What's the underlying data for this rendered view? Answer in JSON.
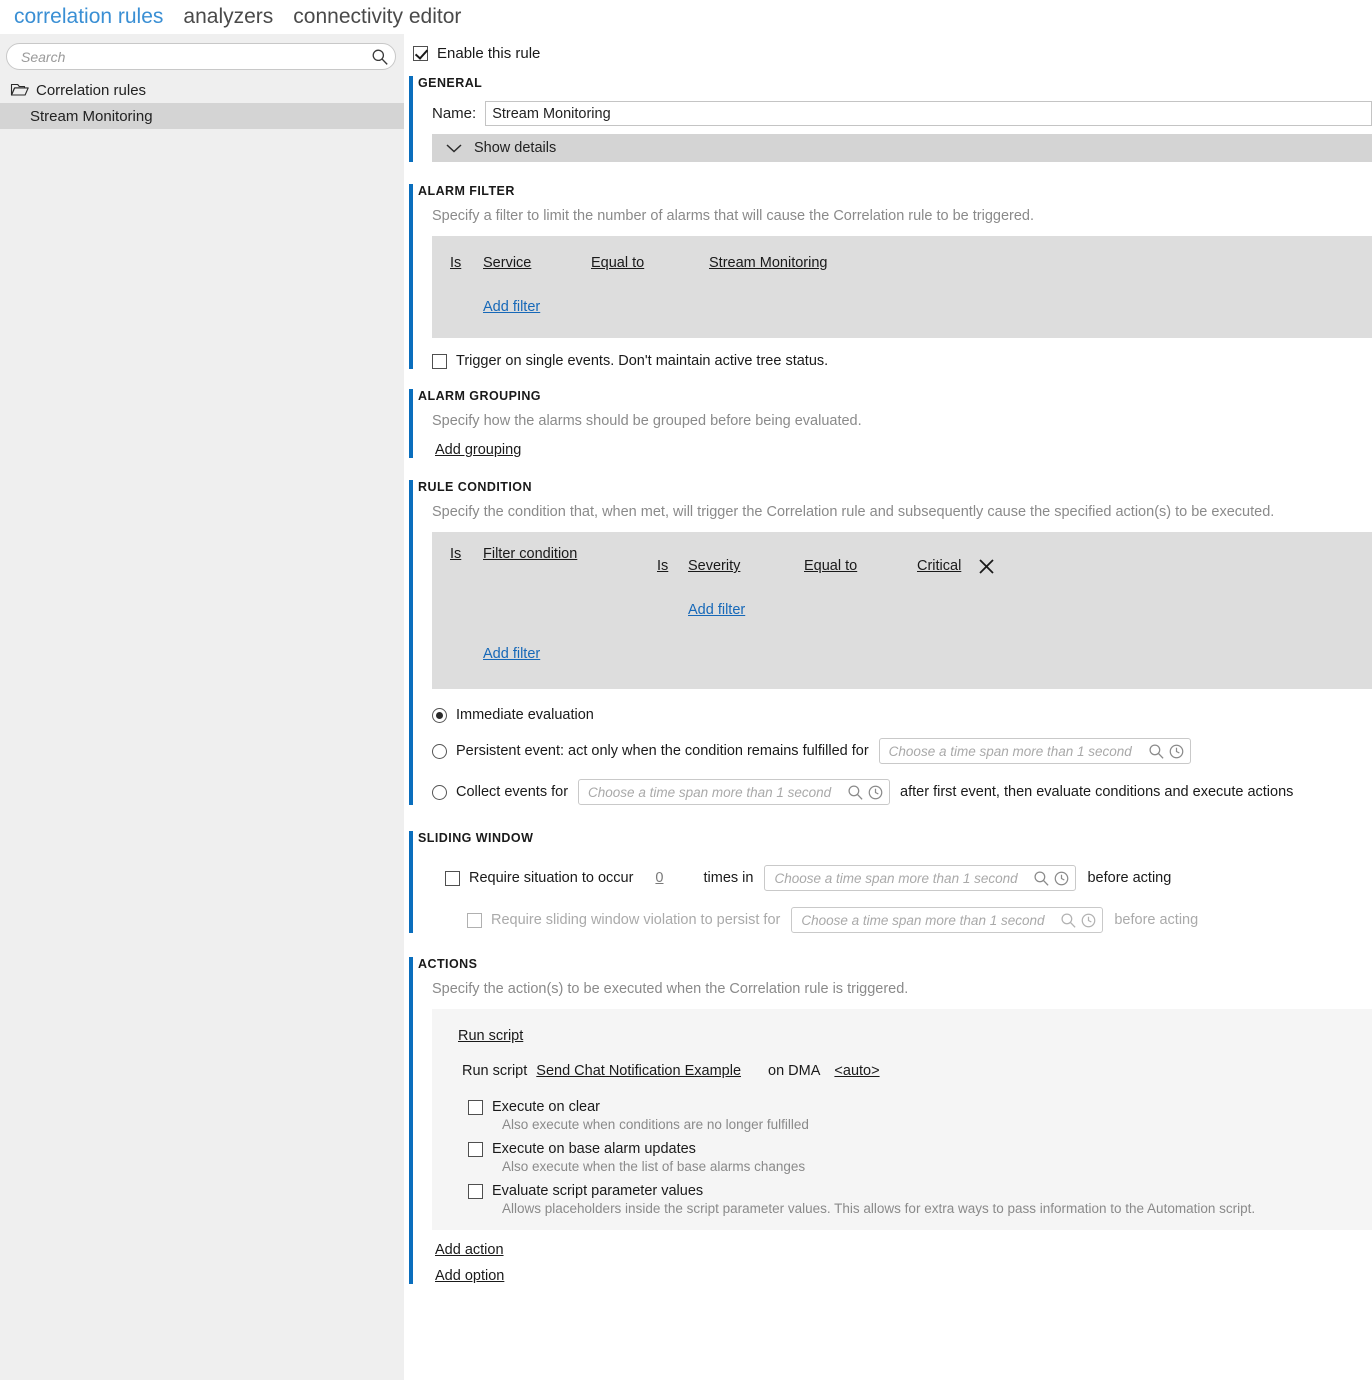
{
  "tabs": [
    {
      "label": "correlation rules",
      "active": true
    },
    {
      "label": "analyzers",
      "active": false
    },
    {
      "label": "connectivity editor",
      "active": false
    }
  ],
  "sidebar": {
    "search": {
      "placeholder": "Search",
      "value": "",
      "icon": "search-icon"
    },
    "tree": [
      {
        "label": "Correlation rules",
        "icon": "folder-open-icon",
        "level": 0,
        "selected": false
      },
      {
        "label": "Stream Monitoring",
        "icon": "",
        "level": 1,
        "selected": true
      }
    ]
  },
  "enable_rule": {
    "label": "Enable this rule",
    "checked": true
  },
  "general": {
    "title": "GENERAL",
    "name_label": "Name:",
    "name_value": "Stream Monitoring",
    "name_placeholder": "",
    "show_details": "Show details"
  },
  "alarm_filter": {
    "title": "ALARM FILTER",
    "description": "Specify a filter to limit the number of alarms that will cause the Correlation rule to be triggered.",
    "row": {
      "is": "Is",
      "field": "Service",
      "operator": "Equal to",
      "value": "Stream Monitoring"
    },
    "add_filter": "Add filter",
    "trigger_single": {
      "label": "Trigger on single events. Don't maintain active tree status.",
      "checked": false
    }
  },
  "alarm_grouping": {
    "title": "ALARM GROUPING",
    "description": "Specify how the alarms should be grouped before being evaluated.",
    "add_grouping": "Add grouping"
  },
  "rule_condition": {
    "title": "RULE CONDITION",
    "description": "Specify the condition that, when met, will trigger the Correlation rule and subsequently cause the specified action(s) to be executed.",
    "outer": {
      "is": "Is",
      "field": "Filter condition"
    },
    "inner": {
      "is": "Is",
      "field": "Severity",
      "operator": "Equal to",
      "value": "Critical",
      "remove_icon": "close-icon"
    },
    "inner_add_filter": "Add filter",
    "outer_add_filter": "Add filter",
    "evaluation": [
      {
        "label": "Immediate evaluation",
        "selected": true
      },
      {
        "label": "Persistent event: act only when the condition remains fulfilled for",
        "selected": false,
        "timespan_placeholder": "Choose a time span more than 1 second"
      },
      {
        "label": "Collect events for",
        "selected": false,
        "timespan_placeholder": "Choose a time span more than 1 second",
        "suffix": "after first event, then evaluate conditions and execute actions"
      }
    ]
  },
  "sliding_window": {
    "title": "SLIDING WINDOW",
    "require_occur": {
      "checked": false,
      "prefix": "Require situation to occur",
      "count": "0",
      "middle": "times in",
      "timespan_placeholder": "Choose a time span more than 1 second",
      "suffix": "before acting"
    },
    "require_persist": {
      "checked": false,
      "disabled": true,
      "prefix": "Require sliding window violation to persist for",
      "timespan_placeholder": "Choose a time span more than 1 second",
      "suffix": "before acting"
    }
  },
  "actions": {
    "title": "ACTIONS",
    "description": "Specify the action(s) to be executed when the Correlation rule is triggered.",
    "run_script_header": "Run script",
    "run_script_row": {
      "prefix": "Run script",
      "script": "Send Chat Notification Example",
      "middle": "on DMA",
      "dma": "<auto>"
    },
    "options": [
      {
        "label": "Execute on clear",
        "checked": false,
        "description": "Also execute when conditions are no longer fulfilled"
      },
      {
        "label": "Execute on base alarm updates",
        "checked": false,
        "description": "Also execute when the list of base alarms changes"
      },
      {
        "label": "Evaluate script parameter values",
        "checked": false,
        "description": "Allows placeholders inside the script parameter values. This allows for extra ways to pass information to the Automation script."
      }
    ],
    "add_action": "Add action",
    "add_option": "Add option"
  },
  "colors": {
    "accent_blue": "#0a6ebd",
    "tab_active": "#3a8fd4",
    "link_blue": "#1668b8",
    "panel_gray": "#dddddd",
    "panel_light": "#f5f5f5",
    "sidebar_bg": "#efefef",
    "selected_row": "#d4d4d4"
  }
}
